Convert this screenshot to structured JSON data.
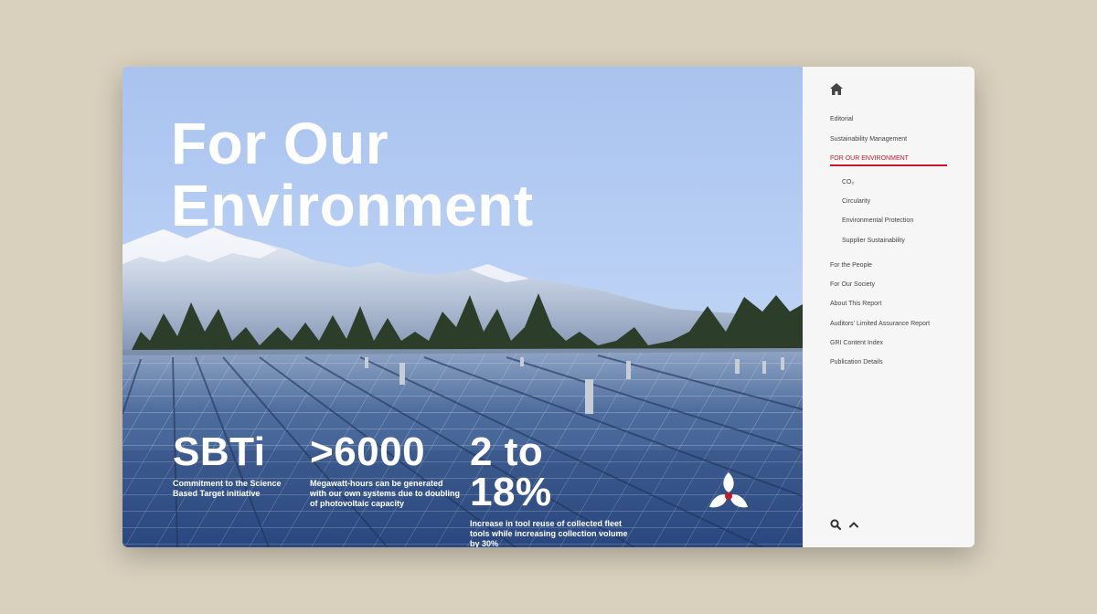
{
  "hero": {
    "title_line1": "For Our",
    "title_line2": "Environment",
    "stats": [
      {
        "value": "SBTi",
        "description": "Commitment to the Science Based Target initiative"
      },
      {
        "value": ">6000",
        "description": "Megawatt-hours can be generated with our own systems due to doubling of photovoltaic capacity"
      },
      {
        "value": "2 to 18%",
        "description": "Increase in tool reuse of collected fleet tools while increasing collection volume by 30%"
      }
    ],
    "logo_icon": "trefoil-logo-icon"
  },
  "sidebar": {
    "home_icon": "home-icon",
    "nav": [
      {
        "label": "Editorial"
      },
      {
        "label": "Sustainability Management"
      },
      {
        "label": "FOR OUR ENVIRONMENT",
        "active": true
      },
      {
        "label": "CO₂"
      },
      {
        "label": "Circularity"
      },
      {
        "label": "Environmental Protection"
      },
      {
        "label": "Supplier Sustainability"
      },
      {
        "label": "For the People"
      },
      {
        "label": "For Our Society"
      },
      {
        "label": "About This Report"
      },
      {
        "label": "Auditors' Limited Assurance Report"
      },
      {
        "label": "GRI Content Index"
      },
      {
        "label": "Publication Details"
      }
    ],
    "search_icon": "search-icon",
    "up_icon": "chevron-up-icon"
  },
  "colors": {
    "accent": "#c4182d",
    "page_background": "#d9d0bd",
    "sidebar_background": "#f6f6f6"
  }
}
